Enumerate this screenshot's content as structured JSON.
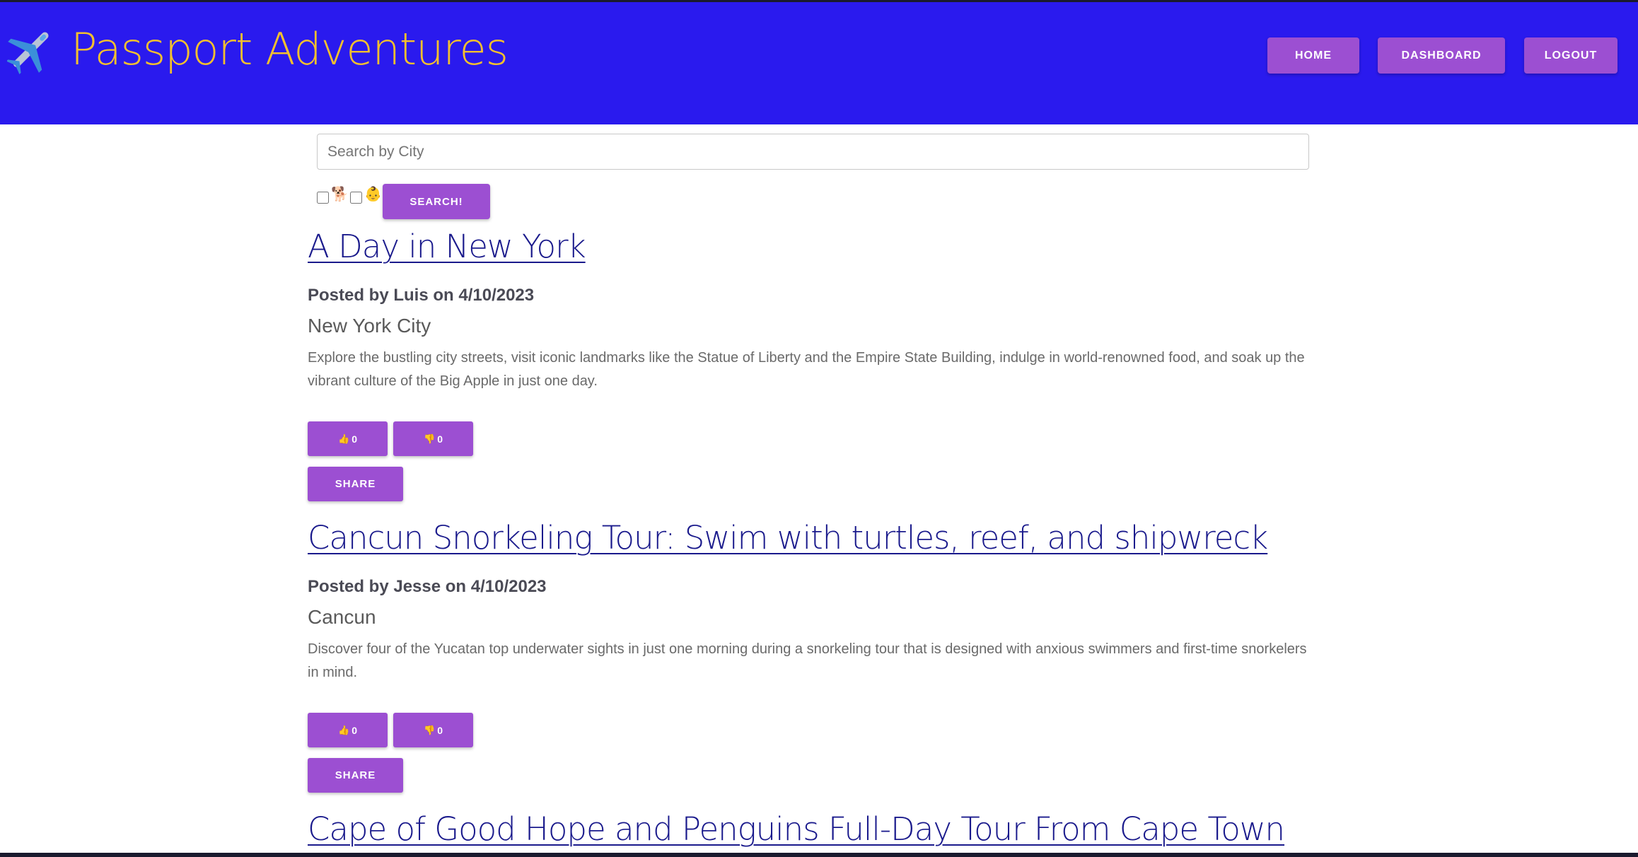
{
  "colors": {
    "header_bg": "#2a1aee",
    "brand_text": "#f3c02e",
    "button_bg": "#9c4fd2",
    "title_link": "#1a1a8c"
  },
  "header": {
    "logo_icon": "airplane-icon",
    "brand": "Passport Adventures",
    "nav": {
      "home": "HOME",
      "dashboard": "DASHBOARD",
      "logout": "LOGOUT"
    }
  },
  "search": {
    "placeholder": "Search by City",
    "value": "",
    "filters": [
      {
        "icon": "dog-icon",
        "glyph": "🐕",
        "checked": false
      },
      {
        "icon": "baby-icon",
        "glyph": "👶",
        "checked": false
      }
    ],
    "button_label": "SEARCH!"
  },
  "posts": [
    {
      "title": "A Day in New York",
      "meta": "Posted by Luis on 4/10/2023",
      "city": "New York City",
      "description": "Explore the bustling city streets, visit iconic landmarks like the Statue of Liberty and the Empire State Building, indulge in world-renowned food, and soak up the vibrant culture of the Big Apple in just one day.",
      "likes": "0",
      "dislikes": "0",
      "like_icon": "👍",
      "dislike_icon": "👎",
      "share_label": "SHARE"
    },
    {
      "title": "Cancun Snorkeling Tour: Swim with turtles, reef, and shipwreck",
      "meta": "Posted by Jesse on 4/10/2023",
      "city": "Cancun",
      "description": "Discover four of the Yucatan top underwater sights in just one morning during a snorkeling tour that is designed with anxious swimmers and first-time snorkelers in mind.",
      "likes": "0",
      "dislikes": "0",
      "like_icon": "👍",
      "dislike_icon": "👎",
      "share_label": "SHARE"
    },
    {
      "title": "Cape of Good Hope and Penguins Full-Day Tour From Cape Town"
    }
  ]
}
